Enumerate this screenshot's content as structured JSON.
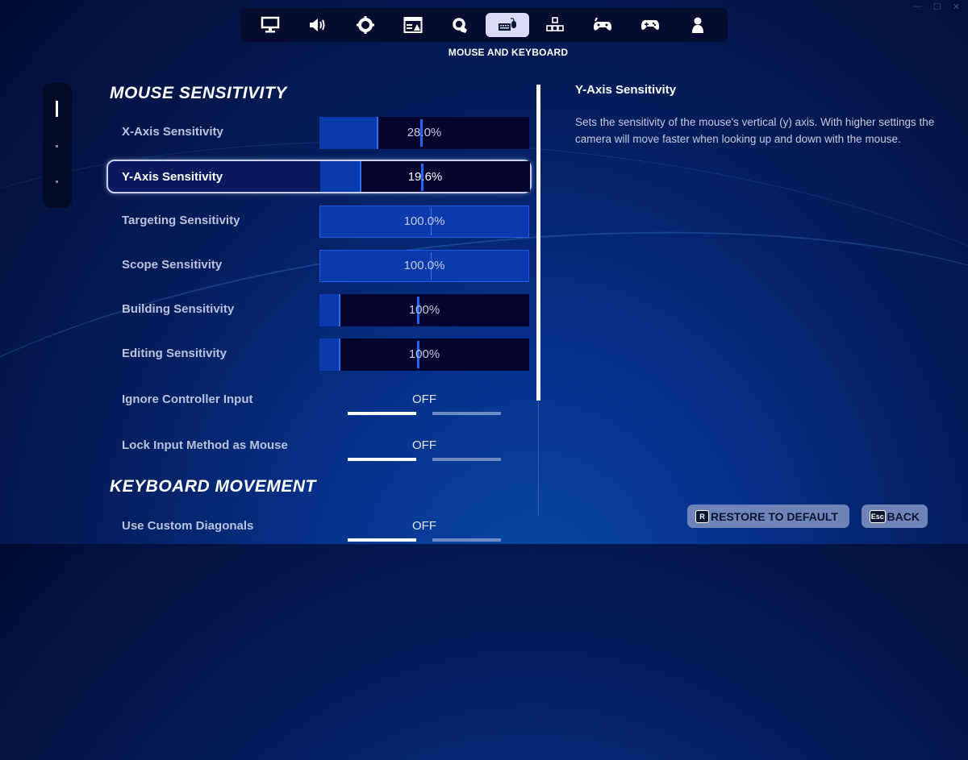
{
  "window_controls": {
    "minimize": "—",
    "maximize": "☐",
    "close": "✕"
  },
  "top_nav": {
    "tabs": [
      {
        "name": "display",
        "icon": "monitor-icon",
        "active": false
      },
      {
        "name": "audio",
        "icon": "speaker-icon",
        "active": false
      },
      {
        "name": "game",
        "icon": "gear-icon",
        "active": false
      },
      {
        "name": "accessibility",
        "icon": "window-icon",
        "active": false
      },
      {
        "name": "touch",
        "icon": "touch-gear-icon",
        "active": false
      },
      {
        "name": "mouse-and-keyboard",
        "icon": "keyboard-mouse-icon",
        "active": true
      },
      {
        "name": "keybinds",
        "icon": "arrow-keys-icon",
        "active": false
      },
      {
        "name": "controller-settings",
        "icon": "controller-gear-icon",
        "active": false
      },
      {
        "name": "controller",
        "icon": "gamepad-icon",
        "active": false
      },
      {
        "name": "account",
        "icon": "person-icon",
        "active": false
      }
    ],
    "active_caption": "MOUSE AND KEYBOARD"
  },
  "sections": [
    {
      "title": "MOUSE SENSITIVITY"
    },
    {
      "title": "KEYBOARD MOVEMENT"
    }
  ],
  "settings": {
    "x_axis": {
      "label": "X-Axis Sensitivity",
      "value": "28.0%",
      "fill": 0.28
    },
    "y_axis": {
      "label": "Y-Axis Sensitivity",
      "value": "19.6%",
      "fill": 0.196,
      "selected": true
    },
    "targeting": {
      "label": "Targeting Sensitivity",
      "value": "100.0%",
      "fill": 1.0
    },
    "scope": {
      "label": "Scope Sensitivity",
      "value": "100.0%",
      "fill": 1.0
    },
    "building": {
      "label": "Building Sensitivity",
      "value": "100%",
      "fill": 0.1
    },
    "editing": {
      "label": "Editing Sensitivity",
      "value": "100%",
      "fill": 0.1
    },
    "ignore_controller": {
      "label": "Ignore Controller Input",
      "value": "OFF"
    },
    "lock_input": {
      "label": "Lock Input Method as Mouse",
      "value": "OFF"
    },
    "custom_diagonals": {
      "label": "Use Custom Diagonals",
      "value": "OFF"
    }
  },
  "description": {
    "title": "Y-Axis Sensitivity",
    "body": "Sets the sensitivity of the mouse's vertical (y) axis. With higher settings the camera will move faster when looking up and down with the mouse."
  },
  "footer": {
    "restore": {
      "key": "R",
      "label": "RESTORE TO DEFAULT"
    },
    "back": {
      "key": "Esc",
      "label": "BACK"
    }
  },
  "colors": {
    "accent": "#1f66ff",
    "slider_fill": "#0a3aab",
    "slider_bg": "#02042e",
    "button_bg": "#6e84b8"
  }
}
